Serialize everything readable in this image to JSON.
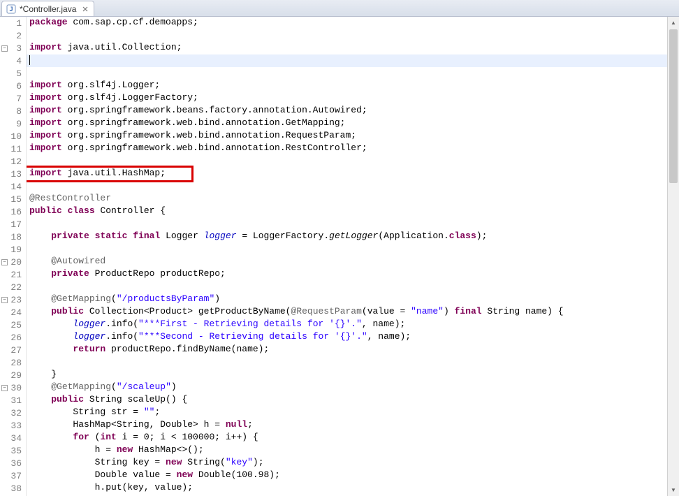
{
  "tab": {
    "title": "*Controller.java"
  },
  "highlight": {
    "line": 13,
    "text": "import java.util.HashMap;"
  },
  "code": {
    "lines": [
      {
        "n": 1,
        "kind": "pkg",
        "tokens": [
          [
            "kw",
            "package"
          ],
          [
            "p",
            " com.sap.cp.cf.demoapps;"
          ]
        ]
      },
      {
        "n": 2,
        "kind": "blank",
        "tokens": []
      },
      {
        "n": 3,
        "kind": "import",
        "fold": true,
        "tokens": [
          [
            "kw",
            "import"
          ],
          [
            "p",
            " java.util.Collection;"
          ]
        ]
      },
      {
        "n": 4,
        "kind": "current",
        "tokens": []
      },
      {
        "n": 5,
        "kind": "blank",
        "tokens": []
      },
      {
        "n": 6,
        "kind": "import",
        "tokens": [
          [
            "kw",
            "import"
          ],
          [
            "p",
            " org.slf4j.Logger;"
          ]
        ]
      },
      {
        "n": 7,
        "kind": "import",
        "tokens": [
          [
            "kw",
            "import"
          ],
          [
            "p",
            " org.slf4j.LoggerFactory;"
          ]
        ]
      },
      {
        "n": 8,
        "kind": "import",
        "tokens": [
          [
            "kw",
            "import"
          ],
          [
            "p",
            " org.springframework.beans.factory.annotation.Autowired;"
          ]
        ]
      },
      {
        "n": 9,
        "kind": "import",
        "tokens": [
          [
            "kw",
            "import"
          ],
          [
            "p",
            " org.springframework.web.bind.annotation.GetMapping;"
          ]
        ]
      },
      {
        "n": 10,
        "kind": "import",
        "tokens": [
          [
            "kw",
            "import"
          ],
          [
            "p",
            " org.springframework.web.bind.annotation.RequestParam;"
          ]
        ]
      },
      {
        "n": 11,
        "kind": "import",
        "tokens": [
          [
            "kw",
            "import"
          ],
          [
            "p",
            " org.springframework.web.bind.annotation.RestController;"
          ]
        ]
      },
      {
        "n": 12,
        "kind": "blank",
        "tokens": []
      },
      {
        "n": 13,
        "kind": "import",
        "change": true,
        "tokens": [
          [
            "kw",
            "import"
          ],
          [
            "p",
            " java.util.HashMap;"
          ]
        ]
      },
      {
        "n": 14,
        "kind": "blank",
        "tokens": []
      },
      {
        "n": 15,
        "kind": "anno",
        "tokens": [
          [
            "anno",
            "@RestController"
          ]
        ]
      },
      {
        "n": 16,
        "kind": "code",
        "tokens": [
          [
            "kw",
            "public"
          ],
          [
            "p",
            " "
          ],
          [
            "kw",
            "class"
          ],
          [
            "p",
            " Controller {"
          ]
        ]
      },
      {
        "n": 17,
        "kind": "blank",
        "tokens": []
      },
      {
        "n": 18,
        "kind": "code",
        "tokens": [
          [
            "p",
            "    "
          ],
          [
            "kw",
            "private"
          ],
          [
            "p",
            " "
          ],
          [
            "kw",
            "static"
          ],
          [
            "p",
            " "
          ],
          [
            "kw",
            "final"
          ],
          [
            "p",
            " Logger "
          ],
          [
            "fieldit",
            "logger"
          ],
          [
            "p",
            " = LoggerFactory."
          ],
          [
            "methit",
            "getLogger"
          ],
          [
            "p",
            "(Application."
          ],
          [
            "kw",
            "class"
          ],
          [
            "p",
            ");"
          ]
        ]
      },
      {
        "n": 19,
        "kind": "blank",
        "tokens": []
      },
      {
        "n": 20,
        "kind": "anno",
        "fold": true,
        "tokens": [
          [
            "p",
            "    "
          ],
          [
            "anno",
            "@Autowired"
          ]
        ]
      },
      {
        "n": 21,
        "kind": "code",
        "tokens": [
          [
            "p",
            "    "
          ],
          [
            "kw",
            "private"
          ],
          [
            "p",
            " ProductRepo productRepo;"
          ]
        ]
      },
      {
        "n": 22,
        "kind": "blank",
        "tokens": []
      },
      {
        "n": 23,
        "kind": "anno",
        "fold": true,
        "tokens": [
          [
            "p",
            "    "
          ],
          [
            "anno",
            "@GetMapping"
          ],
          [
            "p",
            "("
          ],
          [
            "str",
            "\"/productsByParam\""
          ],
          [
            "p",
            ")"
          ]
        ]
      },
      {
        "n": 24,
        "kind": "code",
        "tokens": [
          [
            "p",
            "    "
          ],
          [
            "kw",
            "public"
          ],
          [
            "p",
            " Collection<Product> getProductByName("
          ],
          [
            "anno",
            "@RequestParam"
          ],
          [
            "p",
            "(value = "
          ],
          [
            "str",
            "\"name\""
          ],
          [
            "p",
            ") "
          ],
          [
            "kw",
            "final"
          ],
          [
            "p",
            " String name) {"
          ]
        ]
      },
      {
        "n": 25,
        "kind": "code",
        "tokens": [
          [
            "p",
            "        "
          ],
          [
            "fieldit",
            "logger"
          ],
          [
            "p",
            ".info("
          ],
          [
            "str",
            "\"***First - Retrieving details for '{}'.\""
          ],
          [
            "p",
            ", name);"
          ]
        ]
      },
      {
        "n": 26,
        "kind": "code",
        "tokens": [
          [
            "p",
            "        "
          ],
          [
            "fieldit",
            "logger"
          ],
          [
            "p",
            ".info("
          ],
          [
            "str",
            "\"***Second - Retrieving details for '{}'.\""
          ],
          [
            "p",
            ", name);"
          ]
        ]
      },
      {
        "n": 27,
        "kind": "code",
        "tokens": [
          [
            "p",
            "        "
          ],
          [
            "kw",
            "return"
          ],
          [
            "p",
            " productRepo.findByName(name);"
          ]
        ]
      },
      {
        "n": 28,
        "kind": "blank",
        "tokens": []
      },
      {
        "n": 29,
        "kind": "code",
        "tokens": [
          [
            "p",
            "    }"
          ]
        ]
      },
      {
        "n": 30,
        "kind": "anno",
        "fold": true,
        "tokens": [
          [
            "p",
            "    "
          ],
          [
            "anno",
            "@GetMapping"
          ],
          [
            "p",
            "("
          ],
          [
            "str",
            "\"/scaleup\""
          ],
          [
            "p",
            ")"
          ]
        ]
      },
      {
        "n": 31,
        "kind": "code",
        "tokens": [
          [
            "p",
            "    "
          ],
          [
            "kw",
            "public"
          ],
          [
            "p",
            " String scaleUp() {"
          ]
        ]
      },
      {
        "n": 32,
        "kind": "code",
        "tokens": [
          [
            "p",
            "        String str = "
          ],
          [
            "str",
            "\"\""
          ],
          [
            "p",
            ";"
          ]
        ]
      },
      {
        "n": 33,
        "kind": "code",
        "tokens": [
          [
            "p",
            "        HashMap<String, Double> h = "
          ],
          [
            "kw",
            "null"
          ],
          [
            "p",
            ";"
          ]
        ]
      },
      {
        "n": 34,
        "kind": "code",
        "tokens": [
          [
            "p",
            "        "
          ],
          [
            "kw",
            "for"
          ],
          [
            "p",
            " ("
          ],
          [
            "kw",
            "int"
          ],
          [
            "p",
            " i = 0; i < 100000; i++) {"
          ]
        ]
      },
      {
        "n": 35,
        "kind": "code",
        "tokens": [
          [
            "p",
            "            h = "
          ],
          [
            "kw",
            "new"
          ],
          [
            "p",
            " HashMap<>();"
          ]
        ]
      },
      {
        "n": 36,
        "kind": "code",
        "tokens": [
          [
            "p",
            "            String key = "
          ],
          [
            "kw",
            "new"
          ],
          [
            "p",
            " String("
          ],
          [
            "str",
            "\"key\""
          ],
          [
            "p",
            ");"
          ]
        ]
      },
      {
        "n": 37,
        "kind": "code",
        "tokens": [
          [
            "p",
            "            Double value = "
          ],
          [
            "kw",
            "new"
          ],
          [
            "p",
            " Double(100.98);"
          ]
        ]
      },
      {
        "n": 38,
        "kind": "code",
        "tokens": [
          [
            "p",
            "            h.put(key, value);"
          ]
        ]
      }
    ]
  }
}
